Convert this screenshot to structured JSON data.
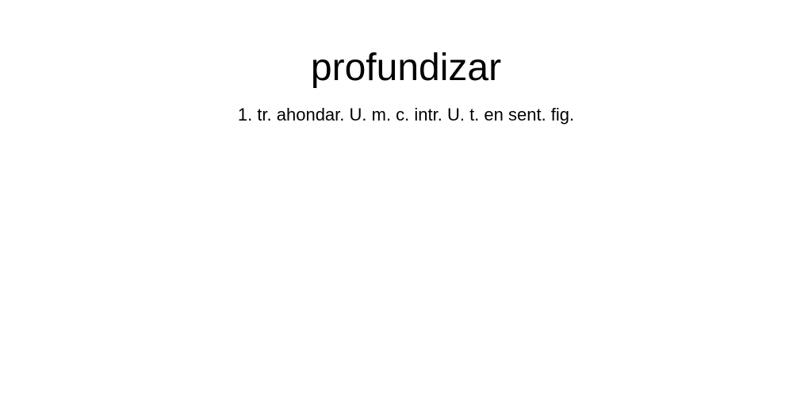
{
  "entry": {
    "headword": "profundizar",
    "definition": "1. tr. ahondar. U. m. c. intr. U. t. en sent. fig."
  }
}
